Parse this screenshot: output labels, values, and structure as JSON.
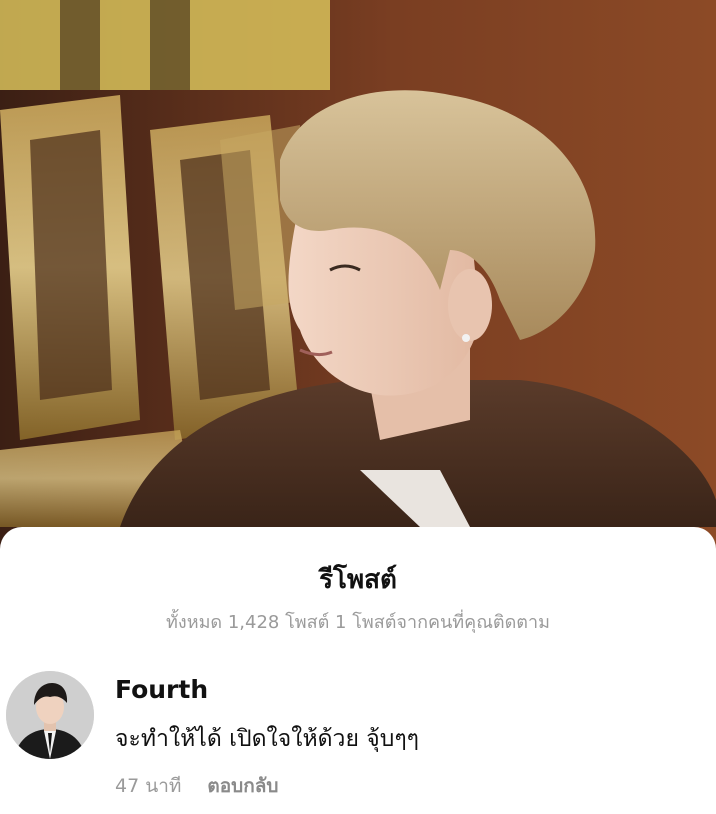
{
  "media": {
    "description_icon": "video-frame-image"
  },
  "sheet": {
    "title": "รีโพสต์",
    "subtitle": "ทั้งหมด 1,428 โพสต์ 1 โพสต์จากคนที่คุณติดตาม"
  },
  "comment": {
    "author": "Fourth",
    "text": "จะทำให้ได้ เปิดใจให้ด้วย จุ้บๆๆ",
    "time": "47 นาที",
    "reply_label": "ตอบกลับ"
  },
  "colors": {
    "background": "#ffffff",
    "primary_text": "#111111",
    "secondary_text": "#9a9a9a"
  }
}
